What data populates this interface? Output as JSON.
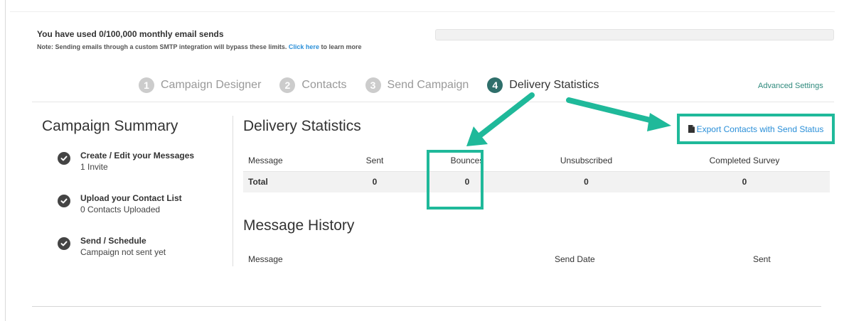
{
  "usage": {
    "title": "You have used 0/100,000 monthly email sends",
    "note_prefix": "Note: Sending emails through a custom SMTP integration will bypass these limits.",
    "note_link": "Click here",
    "note_suffix": "to learn more",
    "progress": 0
  },
  "steps": [
    {
      "number": "1",
      "label": "Campaign Designer",
      "active": false
    },
    {
      "number": "2",
      "label": "Contacts",
      "active": false
    },
    {
      "number": "3",
      "label": "Send Campaign",
      "active": false
    },
    {
      "number": "4",
      "label": "Delivery Statistics",
      "active": true
    }
  ],
  "advanced_settings": "Advanced Settings",
  "summary": {
    "title": "Campaign Summary",
    "items": [
      {
        "title": "Create / Edit your Messages",
        "subtitle": "1 Invite",
        "icon": "check-circle-icon"
      },
      {
        "title": "Upload your Contact List",
        "subtitle": "0 Contacts Uploaded",
        "icon": "check-circle-icon"
      },
      {
        "title": "Send / Schedule",
        "subtitle": "Campaign not sent yet",
        "icon": "check-circle-icon"
      }
    ]
  },
  "delivery": {
    "title": "Delivery Statistics",
    "export_label": "Export Contacts with Send Status",
    "export_icon": "document-icon",
    "columns": [
      "Message",
      "Sent",
      "Bounces",
      "Unsubscribed",
      "Completed Survey"
    ],
    "total_row": [
      "Total",
      "0",
      "0",
      "0",
      "0"
    ]
  },
  "history": {
    "title": "Message History",
    "columns": [
      "Message",
      "Send Date",
      "Sent"
    ]
  },
  "colors": {
    "highlight": "#1fb99a",
    "active_step": "#2f6f6b",
    "link": "#2a8fd8"
  }
}
